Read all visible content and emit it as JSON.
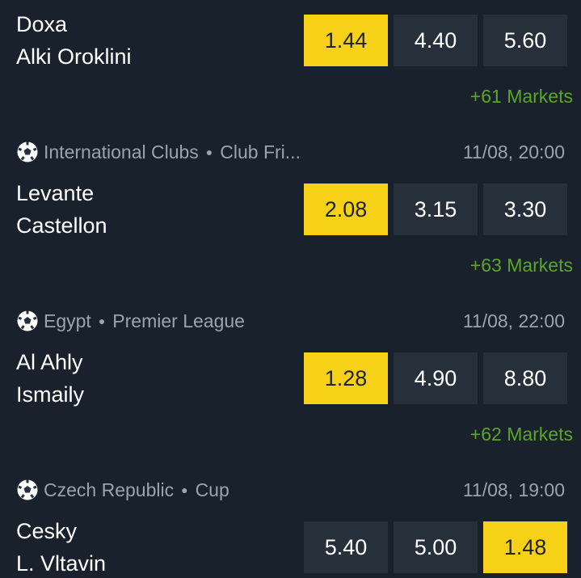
{
  "matches": [
    {
      "league": null,
      "time": null,
      "home": "Doxa",
      "away": "Alki Oroklini",
      "odds": [
        "1.44",
        "4.40",
        "5.60"
      ],
      "selected": 0,
      "markets": "+61 Markets"
    },
    {
      "league": {
        "country": "International Clubs",
        "competition": "Club Fri..."
      },
      "time": "11/08, 20:00",
      "home": "Levante",
      "away": "Castellon",
      "odds": [
        "2.08",
        "3.15",
        "3.30"
      ],
      "selected": 0,
      "markets": "+63 Markets"
    },
    {
      "league": {
        "country": "Egypt",
        "competition": "Premier League"
      },
      "time": "11/08, 22:00",
      "home": "Al Ahly",
      "away": "Ismaily",
      "odds": [
        "1.28",
        "4.90",
        "8.80"
      ],
      "selected": 0,
      "markets": "+62 Markets"
    },
    {
      "league": {
        "country": "Czech Republic",
        "competition": "Cup"
      },
      "time": "11/08, 19:00",
      "home": "Cesky",
      "away": "L. Vltavin",
      "odds": [
        "5.40",
        "5.00",
        "1.48"
      ],
      "selected": 2,
      "markets": null
    }
  ],
  "icons": {
    "sport": "soccer-ball-icon"
  },
  "colors": {
    "background": "#19212c",
    "odd_button": "#26303b",
    "odd_selected": "#f7d117",
    "markets_link": "#5da52a",
    "meta_text": "#9aa3ae"
  }
}
